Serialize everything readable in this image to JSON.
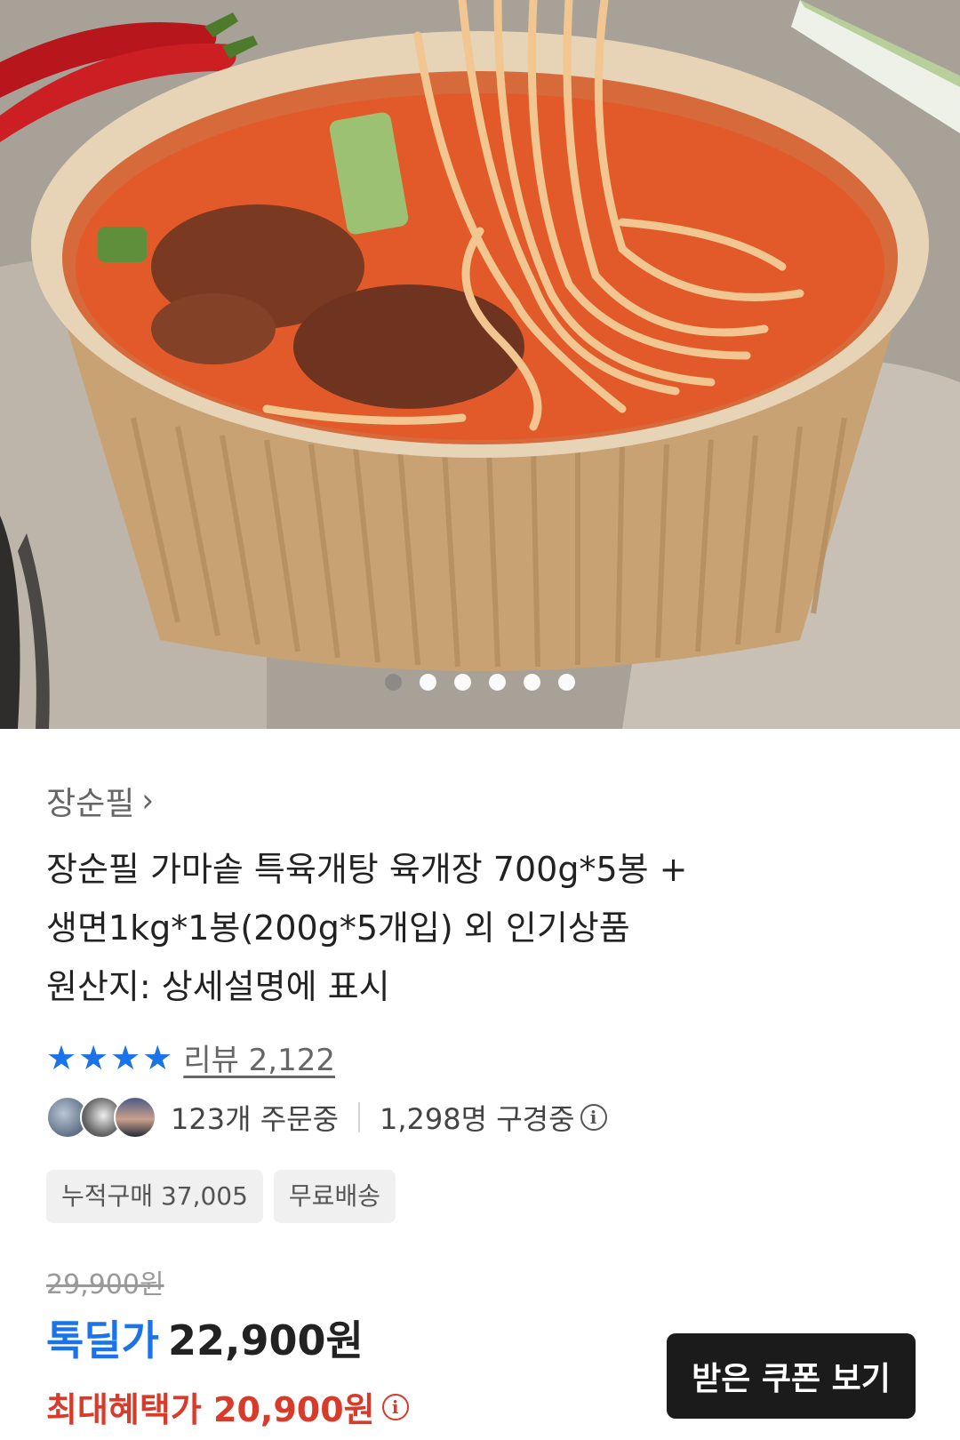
{
  "carousel": {
    "image_alt": "",
    "dot_count": 6,
    "active_index": 0
  },
  "product": {
    "brand": "장순필",
    "title_lines": [
      "장순필 가마솥 특육개탕 육개장 700g*5봉 +",
      "생면1kg*1봉(200g*5개입) 외 인기상품",
      "원산지: 상세설명에 표시"
    ],
    "rating_stars": 4,
    "review_label": "리뷰 2,122",
    "ordering_now": "123개 주문중",
    "viewing_now": "1,298명 구경중",
    "chips": [
      "누적구매 37,005",
      "무료배송"
    ],
    "original_price": "29,900원",
    "deal_label": "톡딜가",
    "deal_price": "22,900원",
    "max_benefit": "최대혜택가 20,900원",
    "coupon_button": "받은 쿠폰 보기"
  },
  "colors": {
    "accent_blue": "#1a73e8",
    "benefit_red": "#d93b2b",
    "button_dark": "#1b1b1b"
  },
  "icons": {
    "chevron": "chevron-right-icon",
    "info": "info-icon",
    "star": "star-icon"
  }
}
